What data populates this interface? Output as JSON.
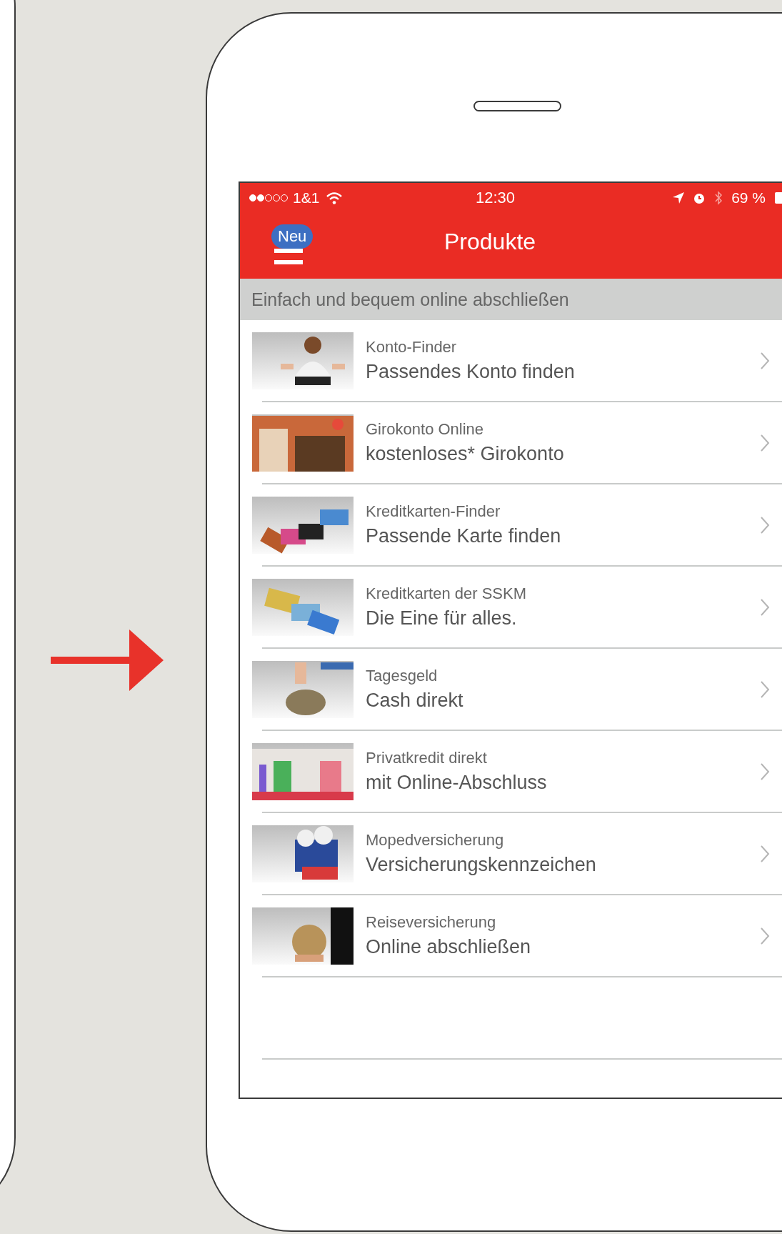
{
  "status_bar": {
    "carrier": "1&1",
    "time": "12:30",
    "battery": "69 %"
  },
  "nav": {
    "badge": "Neu",
    "title": "Produkte"
  },
  "section_header": "Einfach und bequem online abschließen",
  "items": [
    {
      "title": "Konto-Finder",
      "subtitle": "Passendes Konto finden"
    },
    {
      "title": "Girokonto Online",
      "subtitle": "kostenloses* Girokonto"
    },
    {
      "title": "Kreditkarten-Finder",
      "subtitle": "Passende Karte finden"
    },
    {
      "title": "Kreditkarten der SSKM",
      "subtitle": "Die Eine für alles."
    },
    {
      "title": "Tagesgeld",
      "subtitle": "Cash direkt"
    },
    {
      "title": "Privatkredit direkt",
      "subtitle": "mit Online-Abschluss"
    },
    {
      "title": "Mopedversicherung",
      "subtitle": "Versicherungskennzeichen"
    },
    {
      "title": "Reiseversicherung",
      "subtitle": "Online abschließen"
    }
  ]
}
